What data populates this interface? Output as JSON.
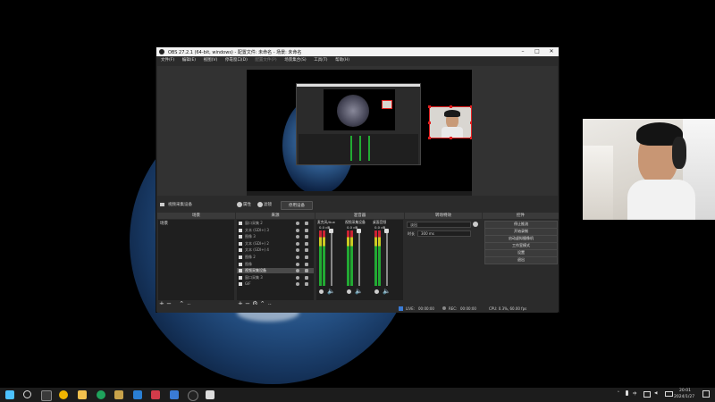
{
  "obs": {
    "title": "OBS 27.2.1 (64-bit, windows) - 配置文件: 未命名 - 场景: 未命名",
    "menu": [
      {
        "label": "文件(F)",
        "dim": false
      },
      {
        "label": "编辑(E)",
        "dim": false
      },
      {
        "label": "视图(V)",
        "dim": false
      },
      {
        "label": "停靠窗口(D)",
        "dim": false
      },
      {
        "label": "配置文件(P)",
        "dim": true
      },
      {
        "label": "场景集合(S)",
        "dim": false
      },
      {
        "label": "工具(T)",
        "dim": false
      },
      {
        "label": "帮助(H)",
        "dim": false
      }
    ],
    "source_toolbar": {
      "selected_source": "视频采集设备",
      "properties": "属性",
      "filters": "滤镜",
      "deactivate": "停用设备"
    },
    "docks": {
      "scenes": {
        "title": "场景",
        "items": [
          "场景"
        ]
      },
      "sources": {
        "title": "来源",
        "items": [
          {
            "name": "窗口采集 2",
            "icon": "window"
          },
          {
            "name": "文本 (GDI+) 3",
            "icon": "text"
          },
          {
            "name": "图像 3",
            "icon": "image"
          },
          {
            "name": "文本 (GDI+) 2",
            "icon": "text"
          },
          {
            "name": "文本 (GDI+) 4",
            "icon": "text"
          },
          {
            "name": "图像 2",
            "icon": "image"
          },
          {
            "name": "图像",
            "icon": "image"
          },
          {
            "name": "视频采集设备",
            "icon": "camera",
            "selected": true
          },
          {
            "name": "窗口采集 3",
            "icon": "window"
          },
          {
            "name": "GIF",
            "icon": "image"
          }
        ]
      },
      "mixer": {
        "title": "混音器",
        "channels": [
          {
            "name": "麦克风/Aux",
            "db": "0.0 dB"
          },
          {
            "name": "视频采集设备",
            "db": "0.0 dB"
          },
          {
            "name": "桌面音频",
            "db": "0.0 dB"
          }
        ]
      },
      "transitions": {
        "title": "转场特效",
        "type": "淡出",
        "duration_label": "时长",
        "duration_value": "300 ms"
      },
      "controls": {
        "title": "控件",
        "buttons": [
          "停止推流",
          "开始录制",
          "启动虚拟摄像机",
          "工作室模式",
          "设置",
          "退出"
        ]
      }
    },
    "status": {
      "live_label": "LIVE:",
      "live_time": "00:00:00",
      "rec_label": "REC:",
      "rec_time": "00:00:00",
      "cpu": "CPU: 0.3%, 60.00 fps"
    }
  },
  "taskbar": {
    "time": "20:01",
    "date": "2024/1/27",
    "tray_lang": "中"
  },
  "colors": {
    "accent_red": "#e02020",
    "obs_bg": "#2b2b2b",
    "taskbar": "#1c1c1c"
  }
}
